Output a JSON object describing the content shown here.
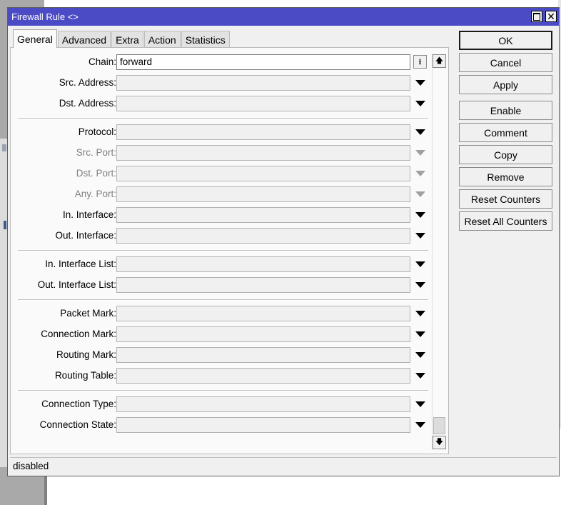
{
  "window": {
    "title": "Firewall Rule <>"
  },
  "tabs": [
    {
      "label": "General",
      "active": true
    },
    {
      "label": "Advanced",
      "active": false
    },
    {
      "label": "Extra",
      "active": false
    },
    {
      "label": "Action",
      "active": false
    },
    {
      "label": "Statistics",
      "active": false
    }
  ],
  "fields": {
    "chain": {
      "label": "Chain:",
      "value": "forward"
    },
    "src_address": {
      "label": "Src. Address:",
      "value": ""
    },
    "dst_address": {
      "label": "Dst. Address:",
      "value": ""
    },
    "protocol": {
      "label": "Protocol:",
      "value": ""
    },
    "src_port": {
      "label": "Src. Port:",
      "value": "",
      "enabled": false
    },
    "dst_port": {
      "label": "Dst. Port:",
      "value": "",
      "enabled": false
    },
    "any_port": {
      "label": "Any. Port:",
      "value": "",
      "enabled": false
    },
    "in_interface": {
      "label": "In. Interface:",
      "value": ""
    },
    "out_interface": {
      "label": "Out. Interface:",
      "value": ""
    },
    "in_interface_list": {
      "label": "In. Interface List:",
      "value": ""
    },
    "out_interface_list": {
      "label": "Out. Interface List:",
      "value": ""
    },
    "packet_mark": {
      "label": "Packet Mark:",
      "value": ""
    },
    "connection_mark": {
      "label": "Connection Mark:",
      "value": ""
    },
    "routing_mark": {
      "label": "Routing Mark:",
      "value": ""
    },
    "routing_table": {
      "label": "Routing Table:",
      "value": ""
    },
    "connection_type": {
      "label": "Connection Type:",
      "value": ""
    },
    "connection_state": {
      "label": "Connection State:",
      "value": ""
    }
  },
  "buttons": {
    "ok": "OK",
    "cancel": "Cancel",
    "apply": "Apply",
    "enable": "Enable",
    "comment": "Comment",
    "copy": "Copy",
    "remove": "Remove",
    "reset_counters": "Reset Counters",
    "reset_all_counters": "Reset All Counters"
  },
  "status": {
    "text": "disabled"
  },
  "icons": {
    "titlebar_maximize": "maximize-icon",
    "titlebar_close": "close-icon",
    "dropdown": "triangle-down-icon",
    "scroll_up": "arrow-up-icon",
    "scroll_down": "arrow-down-icon"
  },
  "colors": {
    "titlebar": "#4b4bc6",
    "window_bg": "#f0f0f0",
    "field_bg": "#f0f0f0",
    "disabled_text": "#808080"
  }
}
